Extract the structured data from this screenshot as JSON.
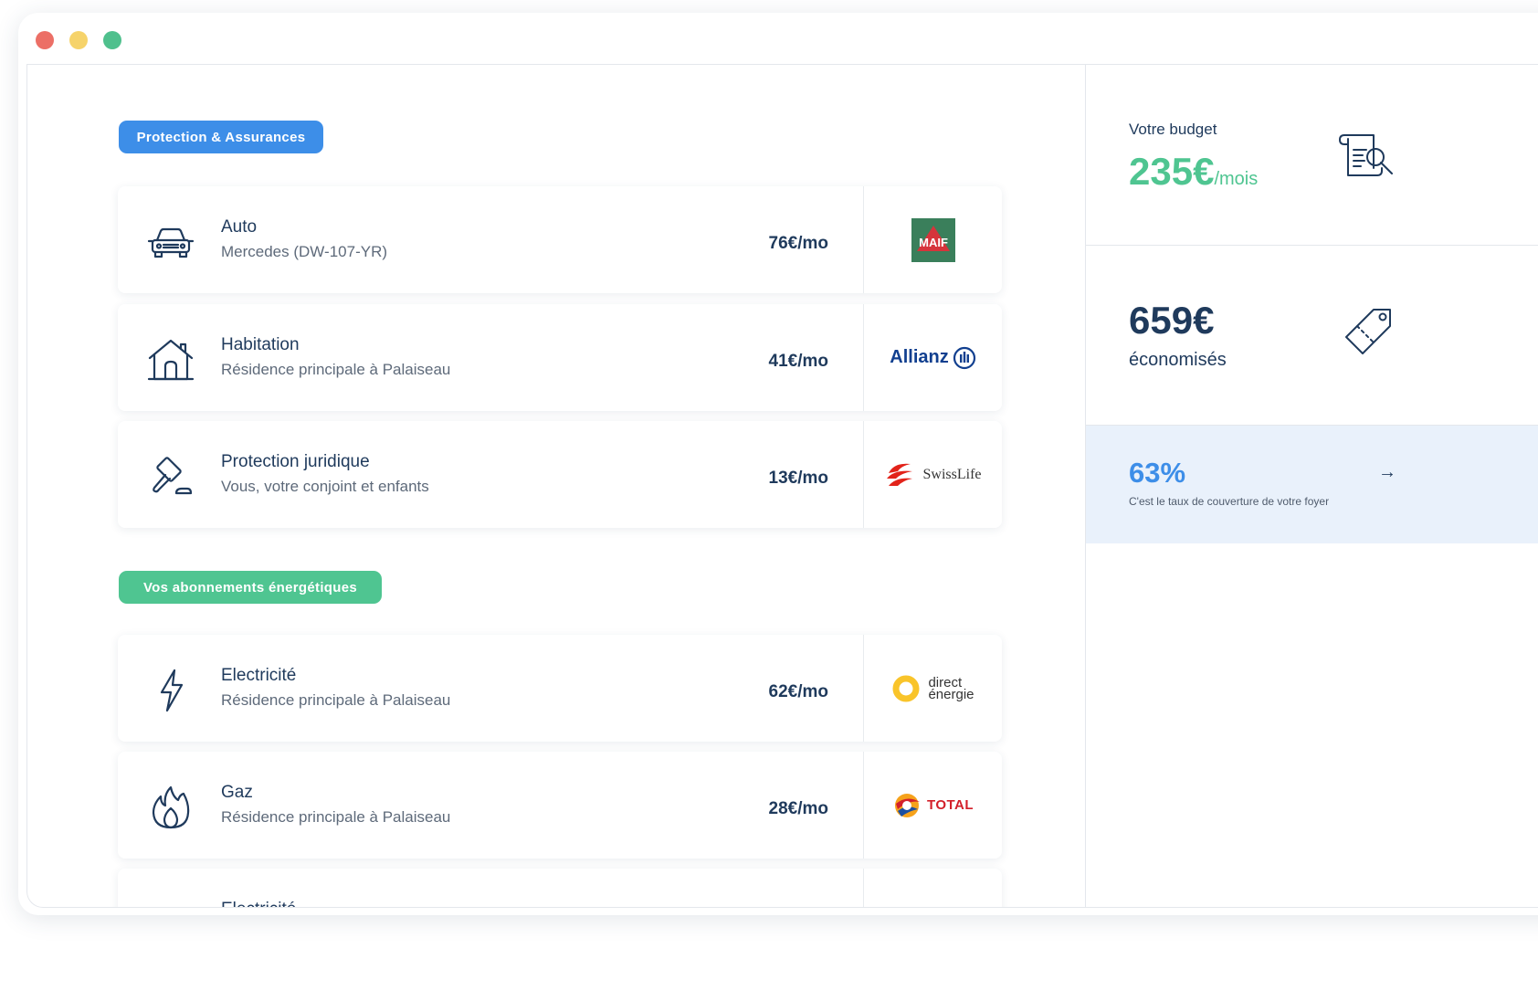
{
  "window": {
    "controls": [
      "close",
      "minimize",
      "maximize"
    ]
  },
  "sections": {
    "insurance": "Protection & Assurances",
    "energy": "Vos abonnements énergétiques"
  },
  "cards": [
    {
      "title": "Auto",
      "subtitle": "Mercedes (DW-107-YR)",
      "price": "76€/mo",
      "icon": "car-icon",
      "provider": "MAIF"
    },
    {
      "title": "Habitation",
      "subtitle": "Résidence principale à Palaiseau",
      "price": "41€/mo",
      "icon": "house-icon",
      "provider": "Allianz"
    },
    {
      "title": "Protection juridique",
      "subtitle": "Vous, votre conjoint et enfants",
      "price": "13€/mo",
      "icon": "gavel-icon",
      "provider": "SwissLife"
    },
    {
      "title": "Electricité",
      "subtitle": "Résidence principale à Palaiseau",
      "price": "62€/mo",
      "icon": "lightning-icon",
      "provider_line1": "direct",
      "provider_line2": "énergie"
    },
    {
      "title": "Gaz",
      "subtitle": "Résidence principale à Palaiseau",
      "price": "28€/mo",
      "icon": "flame-icon",
      "provider": "TOTAL"
    },
    {
      "title": "Electricité"
    }
  ],
  "sidebar": {
    "budget": {
      "label": "Votre budget",
      "value": "235€",
      "unit": "/mois",
      "icon": "document-search-icon"
    },
    "savings": {
      "value": "659€",
      "label": "économisés",
      "icon": "price-tag-icon"
    },
    "coverage": {
      "value": "63%",
      "label": "C'est le taux de couverture de votre foyer",
      "icon": "arrow-right-icon"
    }
  },
  "colors": {
    "navy": "#1f3a5c",
    "blue": "#3d8ee8",
    "green": "#4fc591",
    "coverage_bg": "#e9f1fb",
    "maif_green": "#3a7f5b",
    "maif_red": "#d6343b",
    "allianz_blue": "#113f8f",
    "swisslife_red": "#e2231a",
    "direct_yellow": "#f9c42a",
    "total_red": "#d3202a"
  }
}
